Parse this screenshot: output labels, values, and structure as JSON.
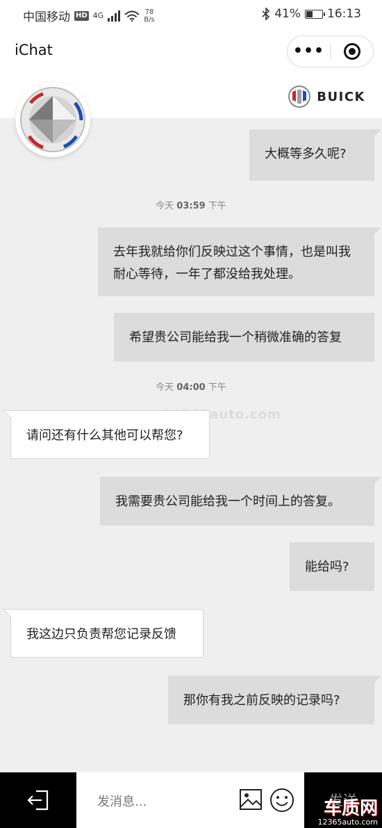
{
  "status_bar": {
    "carrier": "中国移动",
    "hd": "HD",
    "network": "4G",
    "speed_value": "78",
    "speed_unit": "B/s",
    "battery_percent": "41%",
    "battery_level": 0.41,
    "time": "16:13"
  },
  "nav": {
    "title": "iChat",
    "more_label": "•••"
  },
  "header": {
    "brand": "BUICK"
  },
  "timestamps": [
    {
      "day": "今天",
      "time": "03:59",
      "period": "下午"
    },
    {
      "day": "今天",
      "time": "04:00",
      "period": "下午"
    }
  ],
  "messages": [
    {
      "from": "me",
      "text": "大概等多久呢?"
    },
    {
      "from": "me",
      "text": "去年我就给你们反映过这个事情，也是叫我耐心等待，一年了都没给我处理。"
    },
    {
      "from": "me",
      "text": "希望贵公司能给我一个稍微准确的答复"
    },
    {
      "from": "other",
      "text": "请问还有什么其他可以帮您?"
    },
    {
      "from": "me",
      "text": "我需要贵公司能给我一个时间上的答复。"
    },
    {
      "from": "me",
      "text": "能给吗?"
    },
    {
      "from": "other",
      "text": "我这边只负责帮您记录反馈"
    },
    {
      "from": "me",
      "text": "那你有我之前反映的记录吗?"
    }
  ],
  "watermark": "www.12365auto.com",
  "composer": {
    "placeholder": "发消息...",
    "send_label": "发送"
  },
  "corner_logo": {
    "name": "车质网",
    "url": "12365auto.com"
  }
}
